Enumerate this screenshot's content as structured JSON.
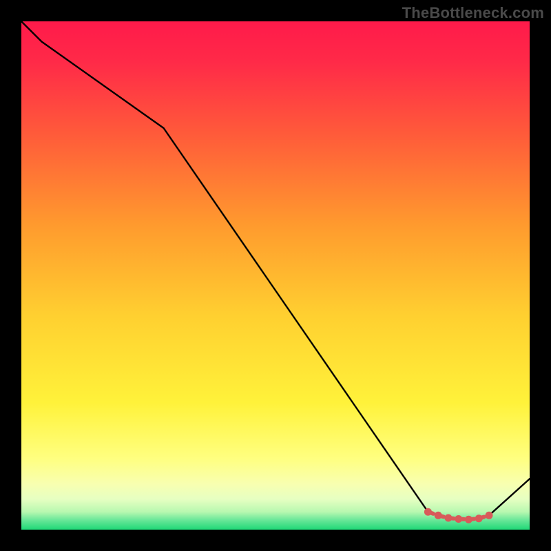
{
  "watermark": "TheBottleneck.com",
  "colors": {
    "gradient_top": "#ff1a4a",
    "gradient_mid_upper": "#ff8a2a",
    "gradient_mid": "#ffe236",
    "gradient_low": "#ffff99",
    "gradient_band": "#f1ffbf",
    "gradient_bottom": "#20e07a",
    "line": "#000000",
    "marker": "#d85a5a",
    "frame": "#000000"
  },
  "chart_data": {
    "type": "line",
    "title": "",
    "xlabel": "",
    "ylabel": "",
    "xlim": [
      0,
      100
    ],
    "ylim": [
      0,
      100
    ],
    "x": [
      0,
      4,
      28,
      80,
      82,
      84,
      86,
      88,
      90,
      92,
      100
    ],
    "values": [
      100,
      96,
      79,
      3.5,
      2.8,
      2.3,
      2.1,
      2.0,
      2.2,
      2.8,
      10
    ],
    "marker_region": {
      "x": [
        80,
        82,
        84,
        86,
        88,
        90,
        92
      ],
      "values": [
        3.5,
        2.8,
        2.3,
        2.1,
        2.0,
        2.2,
        2.8
      ]
    }
  }
}
